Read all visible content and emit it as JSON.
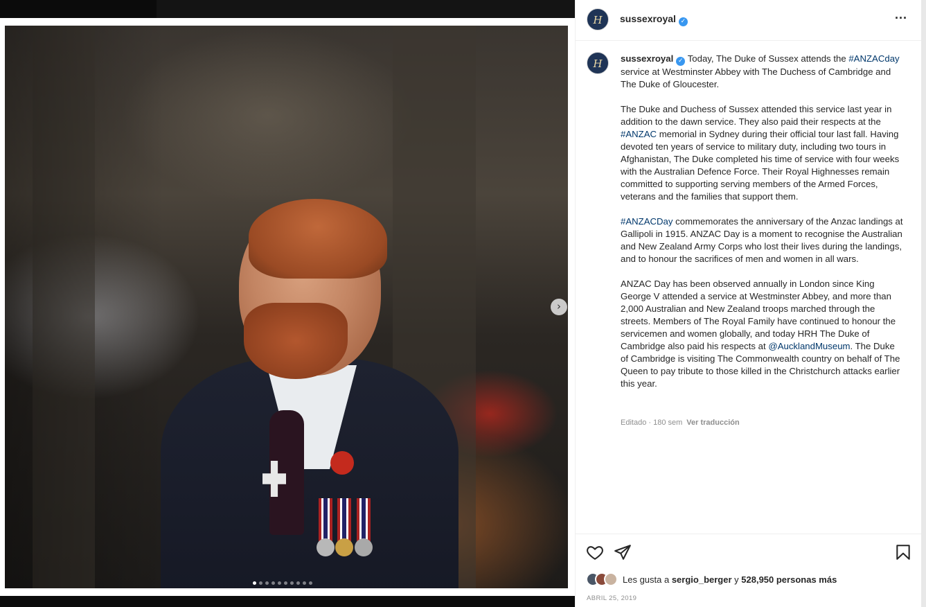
{
  "post": {
    "username": "sussexroyal",
    "verified_mark": "✓",
    "avatar_monogram": "H",
    "more_icon": "···",
    "caption_paragraphs": [
      [
        {
          "t": "Today, The Duke of Sussex attends the ",
          "tag": false
        },
        {
          "t": "#ANZACday",
          "tag": true
        },
        {
          "t": " service at Westminster Abbey with The Duchess of Cambridge and The Duke of Gloucester.",
          "tag": false
        }
      ],
      [
        {
          "t": "The Duke and Duchess of Sussex attended this service last year in addition to the dawn service. They also paid their respects at the ",
          "tag": false
        },
        {
          "t": "#ANZAC",
          "tag": true
        },
        {
          "t": " memorial in Sydney during their official tour last fall. Having devoted ten years of service to military duty, including two tours in Afghanistan, The Duke completed his time of service with four weeks with the Australian Defence Force. Their Royal Highnesses remain committed to supporting serving members of the Armed Forces, veterans and the families that support them.",
          "tag": false
        }
      ],
      [
        {
          "t": "#ANZACDay",
          "tag": true
        },
        {
          "t": " commemorates the anniversary of the Anzac landings at Gallipoli in 1915. ANZAC Day is a moment to recognise the Australian and New Zealand Army Corps who lost their lives during the landings, and to honour the sacrifices of men and women in all wars.",
          "tag": false
        }
      ],
      [
        {
          "t": "ANZAC Day has been observed annually in London since King George V attended a service at Westminster Abbey, and more than 2,000 Australian and New Zealand troops marched through the streets. Members of The Royal Family have continued to honour the servicemen and women globally, and today HRH The Duke of Cambridge also paid his respects at ",
          "tag": false
        },
        {
          "t": "@AucklandMuseum",
          "tag": true
        },
        {
          "t": ". The Duke of Cambridge is visiting The Commonwealth country on behalf of The Queen to pay tribute to those killed in the Christchurch attacks earlier this year.",
          "tag": false
        }
      ]
    ],
    "edited_label": "Editado · 180 sem",
    "translate_label": "Ver traducción",
    "likes_prefix": "Les gusta a ",
    "likes_user": "sergio_berger",
    "likes_connector": " y ",
    "likes_count": "528,950 personas más",
    "date": "ABRIL 25, 2019",
    "carousel": {
      "total": 10,
      "active_index": 0,
      "next_icon": "›"
    }
  },
  "icons": {
    "like": "heart-icon",
    "share": "paper-plane-icon",
    "save": "bookmark-icon",
    "next": "chevron-right-icon",
    "more": "more-horizontal-icon"
  },
  "colors": {
    "link": "#00376b",
    "verified": "#3897f0",
    "text": "#262626",
    "muted": "#8e8e8e",
    "avatar_bg": "#1f3456"
  }
}
